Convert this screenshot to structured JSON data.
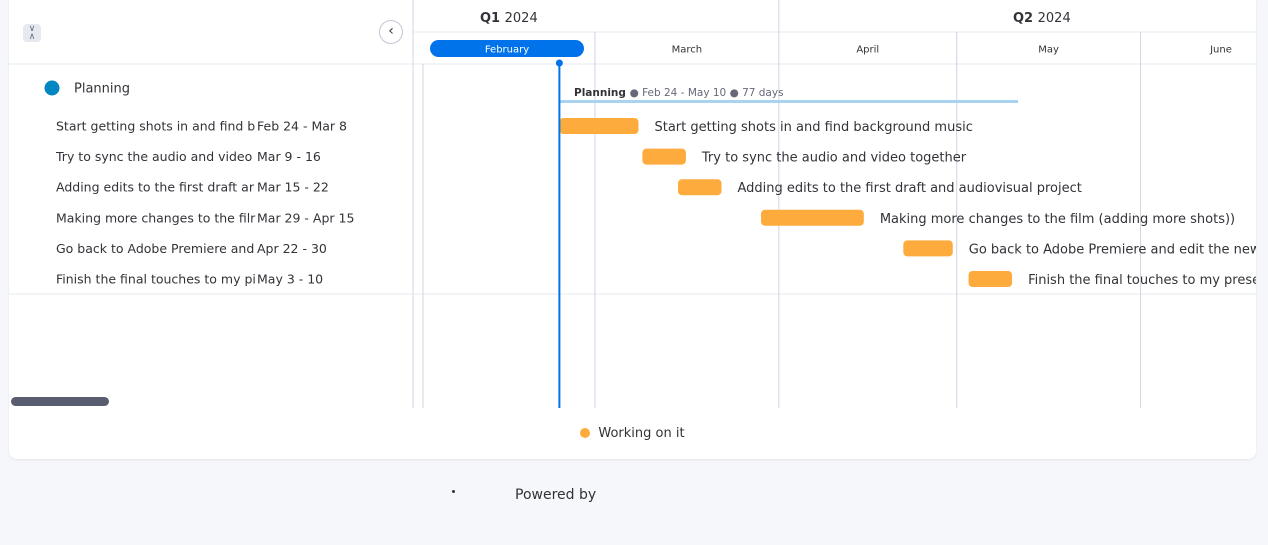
{
  "header": {
    "quarters": [
      {
        "prefix": "Q1",
        "year": "2024"
      },
      {
        "prefix": "Q2",
        "year": "2024"
      }
    ],
    "months": [
      "February",
      "March",
      "April",
      "May",
      "June"
    ],
    "collapse_icon": "collapse-vertical-icon",
    "back_icon": "chevron-left-icon"
  },
  "group": {
    "name": "Planning",
    "color": "#0086c0",
    "summary_name": "Planning",
    "summary_dates": "Feb 24 - May 10",
    "summary_duration": "77 days"
  },
  "tasks": [
    {
      "list_label": "Start getting shots in and find b",
      "dates": "Feb 24 - Mar 8",
      "bar_label": "Start getting shots in and find background music",
      "start": "2024-02-24",
      "end": "2024-03-08"
    },
    {
      "list_label": "Try to sync the audio and video",
      "dates": "Mar 9 - 16",
      "bar_label": "Try to sync the audio and video together",
      "start": "2024-03-09",
      "end": "2024-03-16"
    },
    {
      "list_label": "Adding edits to the first draft ar",
      "dates": "Mar 15 - 22",
      "bar_label": "Adding edits to the first draft and audiovisual project",
      "start": "2024-03-15",
      "end": "2024-03-22"
    },
    {
      "list_label": "Making more changes to the filr",
      "dates": "Mar 29 - Apr 15",
      "bar_label": "Making more changes to the film (adding more shots))",
      "start": "2024-03-29",
      "end": "2024-04-15"
    },
    {
      "list_label": "Go back to Adobe Premiere and",
      "dates": "Apr 22 - 30",
      "bar_label": "Go back to Adobe Premiere and edit the new footage",
      "start": "2024-04-22",
      "end": "2024-04-30"
    },
    {
      "list_label": "Finish the final touches to my pi",
      "dates": "May 3 - 10",
      "bar_label": "Finish the final touches to my presentation",
      "start": "2024-05-03",
      "end": "2024-05-10"
    }
  ],
  "today": "2024-02-24",
  "legend": {
    "label": "Working on it",
    "color": "#fdab3d"
  },
  "footer": {
    "powered_by": "Powered by"
  },
  "colors": {
    "accent": "#0073ea",
    "bar": "#fdab3d",
    "summary_bar": "#a9d3f0",
    "grid": "#d0d4e4"
  }
}
